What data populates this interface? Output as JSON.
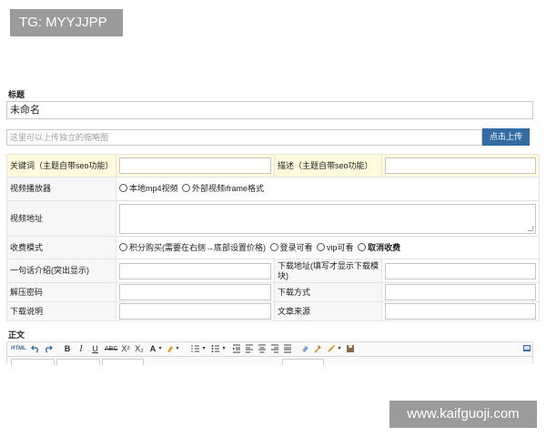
{
  "watermarks": {
    "top": "TG: MYYJJPP",
    "bottom": "www.kaifguoji.com"
  },
  "title_section": {
    "label": "标题",
    "value": "未命名"
  },
  "thumbnail": {
    "placeholder": "这里可以上传独立的缩略图",
    "button_label": "点击上传"
  },
  "meta": {
    "keywords_label": "关键词（主题自带seo功能）",
    "description_label": "描述（主题自带seo功能）",
    "player_label": "视频播放器",
    "player_options": [
      "本地mp4视频",
      "外部视频iframe格式"
    ],
    "video_url_label": "视频地址",
    "charge_label": "收费模式",
    "charge_options": [
      "积分购买(需要在右侧→底部设置价格)",
      "登录可看",
      "vip可看",
      "取消收费"
    ],
    "summary_label": "一句话介绍(突出显示)",
    "download_url_label": "下载地址(填写才显示下载模块)",
    "unzip_label": "解压密码",
    "download_method_label": "下载方式",
    "download_desc_label": "下载说明",
    "source_label": "文章来源"
  },
  "editor": {
    "label": "正文",
    "toolbar": {
      "html": "HTML",
      "bold": "B",
      "italic": "I",
      "underline": "U",
      "strike": "ABC",
      "superscript": "X²",
      "subscript": "X₂",
      "font_color": "A"
    }
  },
  "colors": {
    "accent": "#356ba4",
    "highlight_row": "#fffbdc",
    "watermark": "#9b9b9b"
  }
}
